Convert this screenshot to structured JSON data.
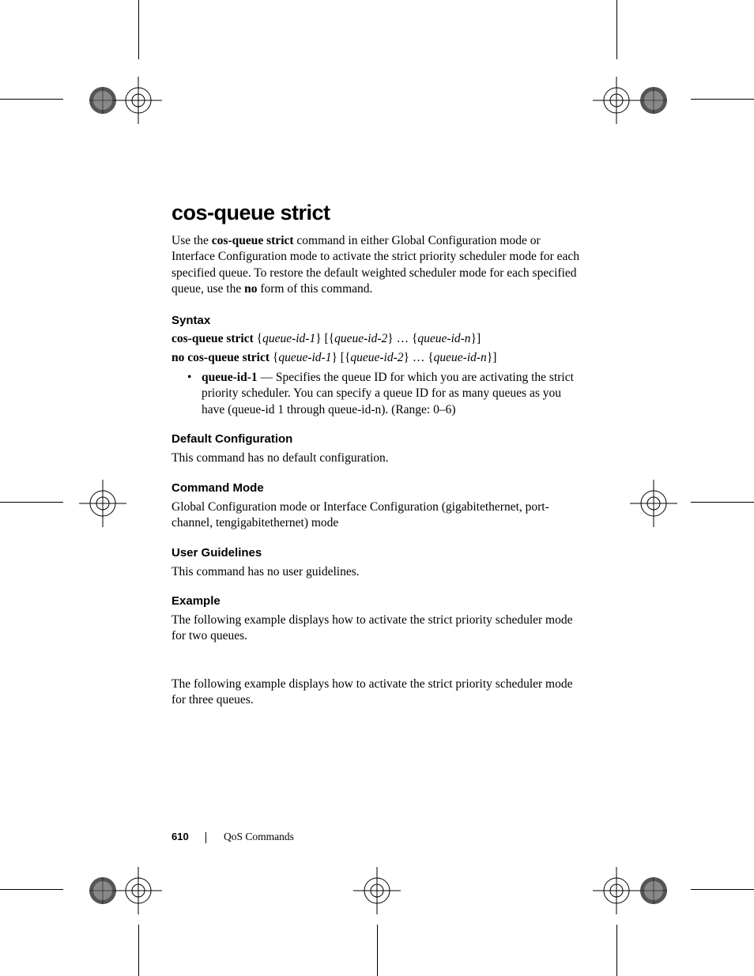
{
  "title": "cos-queue strict",
  "intro_parts": {
    "p1": "Use the ",
    "bold1": "cos-queue strict",
    "p2": " command in either Global Configuration mode or Interface Configuration mode to activate the strict priority scheduler mode for each specified queue. To restore the default weighted scheduler mode for each specified queue, use the ",
    "bold2": "no",
    "p3": " form of this command."
  },
  "syntax": {
    "heading": "Syntax",
    "line1": {
      "cmd": "cos-queue strict",
      "arg1": "queue-id-1",
      "arg2": "queue-id-2",
      "argn": "queue-id-n"
    },
    "line2": {
      "cmd": "no cos-queue strict",
      "arg1": "queue-id-1",
      "arg2": "queue-id-2",
      "argn": "queue-id-n"
    },
    "bullet": {
      "label": "queue-id-1",
      "desc": " — Specifies the queue ID for which you are activating the strict priority scheduler. You can specify a queue ID for as many queues as you have (queue-id 1 through queue-id-n). (Range: 0–6)"
    }
  },
  "default_config": {
    "heading": "Default Configuration",
    "text": "This command has no default configuration."
  },
  "command_mode": {
    "heading": "Command Mode",
    "text": "Global Configuration mode or Interface Configuration (gigabitethernet, port-channel, tengigabitethernet) mode"
  },
  "user_guidelines": {
    "heading": "User Guidelines",
    "text": "This command has no user guidelines."
  },
  "example": {
    "heading": "Example",
    "text1": "The following example displays how to activate the strict priority scheduler mode for two queues.",
    "text2": "The following example displays how to activate the strict priority scheduler mode for three queues."
  },
  "footer": {
    "page_num": "610",
    "section": "QoS Commands"
  }
}
